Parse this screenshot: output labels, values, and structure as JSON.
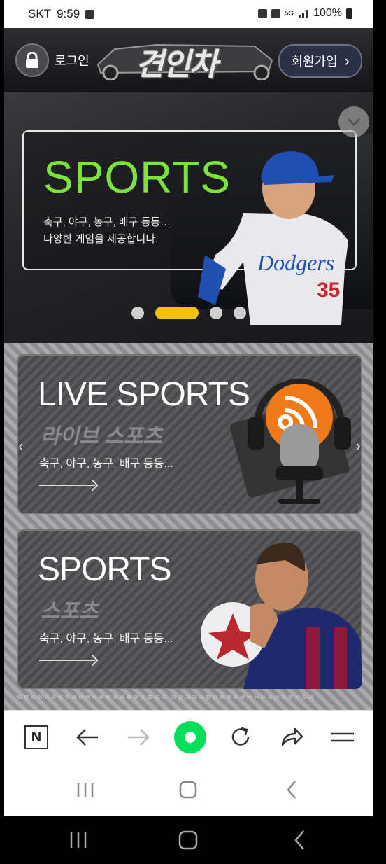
{
  "statusbar": {
    "carrier": "SKT",
    "time": "9:59",
    "battery": "100%",
    "network": "5G"
  },
  "header": {
    "login_label": "로그인",
    "logo_text": "견인차",
    "signup_label": "회원가입",
    "signup_chevron": "›"
  },
  "hero": {
    "title": "SPORTS",
    "description": "축구, 야구, 농구, 배구 등등…\n다양한 게임을 제공합니다.",
    "player_team": "Dodgers",
    "player_number": "35",
    "slides": 4,
    "active_slide": 2,
    "title_color": "#7be33a"
  },
  "sections": [
    {
      "title": "LIVE SPORTS",
      "subtitle": "라이브 스포츠",
      "description": "축구, 야구, 농구, 배구 등등..."
    },
    {
      "title": "SPORTS",
      "subtitle": "스포츠",
      "description": "축구, 야구, 농구, 배구 등등..."
    }
  ],
  "browser_toolbar": {
    "items": [
      "naver-home-icon",
      "back-icon",
      "forward-icon",
      "green-dot-icon",
      "refresh-icon",
      "share-icon",
      "menu-icon"
    ],
    "naver_letter": "N",
    "accent": "#00de5a"
  },
  "navbar": {
    "items": [
      "recent-apps-icon",
      "home-icon",
      "back-icon"
    ]
  }
}
